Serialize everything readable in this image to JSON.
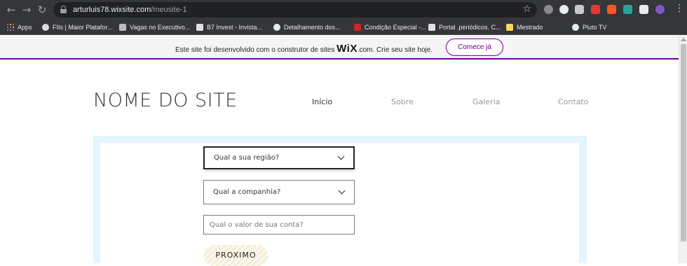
{
  "browser": {
    "url_host": "arturluis78.wixsite.com",
    "url_path": "/meusite-1",
    "nav_back": "←",
    "nav_forward": "→",
    "nav_reload": "↻",
    "bookmark_star": "☆",
    "menu": "⋮",
    "extensions": [
      {
        "name": "shield-extension-icon",
        "color": "#8a8a8a"
      },
      {
        "name": "circle-extension-icon",
        "color": "#e8eaed"
      },
      {
        "name": "square-extension-icon",
        "color": "#c9c9c9"
      },
      {
        "name": "red-extension-icon",
        "color": "#e53935"
      },
      {
        "name": "sc-extension-icon",
        "color": "#ff5722"
      },
      {
        "name": "teal-extension-icon",
        "color": "#26a69a"
      },
      {
        "name": "puzzle-extension-icon",
        "color": "#e8eaed"
      },
      {
        "name": "profile-avatar-icon",
        "color": "#7e57c2"
      }
    ],
    "bookmarks": [
      {
        "label": "Apps",
        "icon": "apps-grid-icon"
      },
      {
        "label": "FIIs | Maior Platafor...",
        "icon": "fiis-icon",
        "color": "#dddddd"
      },
      {
        "label": "Vagas no Executivo...",
        "icon": "vagas-icon",
        "color": "#bdbdbd"
      },
      {
        "label": "B7 Invest - Invista...",
        "icon": "b7-icon",
        "color": "#e0e0e0"
      },
      {
        "label": "Detalhamento dos...",
        "icon": "globe-icon",
        "color": "#e8eaed"
      },
      {
        "label": "Condição Especial -...",
        "icon": "condicao-icon",
        "color": "#c62828"
      },
      {
        "label": "Portal .periódicos. C...",
        "icon": "portal-icon",
        "color": "#e0e0e0"
      },
      {
        "label": "Mestrado",
        "icon": "folder-icon",
        "color": "#f9d65c"
      },
      {
        "label": "Pluto TV",
        "icon": "pluto-icon",
        "color": "#e8eaed"
      }
    ]
  },
  "wix_banner": {
    "text_before": "Este site foi desenvolvido com o construtor de sites ",
    "logo": "WiX",
    "text_after": ".com. Crie seu site hoje.",
    "button": "Comece já",
    "accent": "#74008f"
  },
  "site": {
    "title": "NOME DO SITE",
    "nav": [
      "Início",
      "Sobre",
      "Galeria",
      "Contato"
    ]
  },
  "form": {
    "region_label": "Qual a sua região?",
    "company_label": "Qual a companhia?",
    "value_placeholder": "Qual o valor de sua conta?",
    "next_button": "PROXIMO"
  }
}
